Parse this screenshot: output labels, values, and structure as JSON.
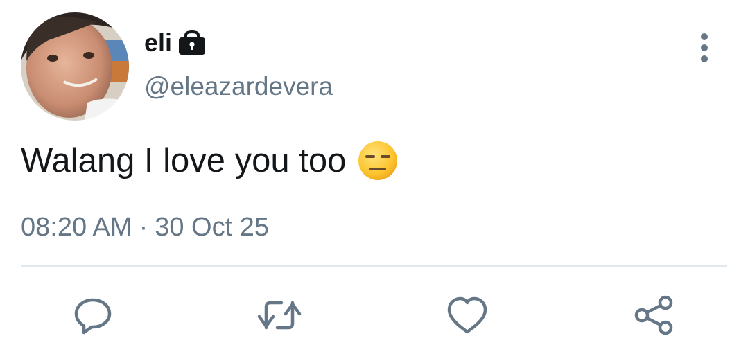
{
  "user": {
    "display_name": "eli",
    "handle": "@eleazardevera",
    "protected_icon": "lock-icon",
    "avatar": "profile-photo"
  },
  "tweet": {
    "text": "Walang I love you too",
    "emoji": "expressionless-face-icon",
    "time": "08:20 AM",
    "separator": "·",
    "date": "30 Oct 25"
  },
  "menu": {
    "icon": "more-vertical-icon"
  },
  "actions": [
    {
      "name": "reply",
      "icon": "reply-icon"
    },
    {
      "name": "retweet",
      "icon": "retweet-icon"
    },
    {
      "name": "like",
      "icon": "heart-icon"
    },
    {
      "name": "share",
      "icon": "share-icon"
    }
  ],
  "colors": {
    "text_primary": "#14171a",
    "text_secondary": "#657786",
    "divider": "#e1e8ed",
    "icon": "#657786"
  }
}
